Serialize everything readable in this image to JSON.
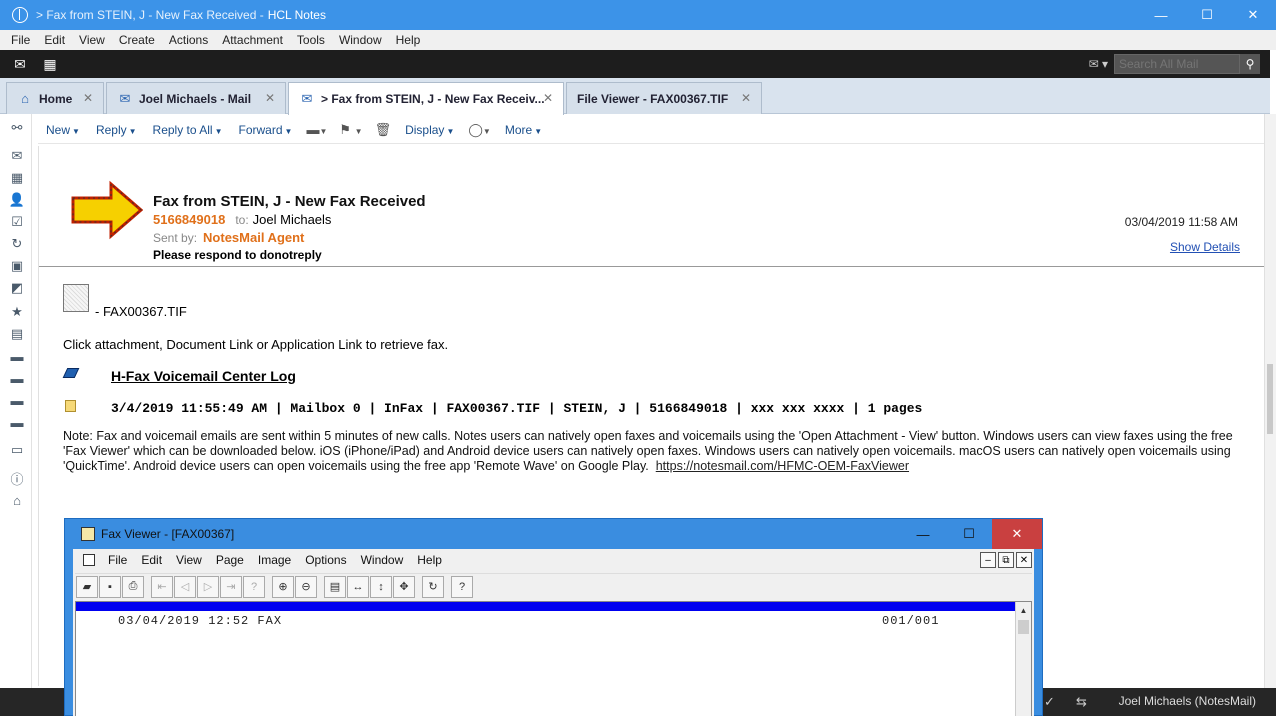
{
  "window": {
    "title_prefix": "> Fax from STEIN, J - New Fax Received  -",
    "app_name": "HCL Notes",
    "min": "—",
    "max": "☐",
    "close": "✕"
  },
  "menu": [
    "File",
    "Edit",
    "View",
    "Create",
    "Actions",
    "Attachment",
    "Tools",
    "Window",
    "Help"
  ],
  "search": {
    "placeholder": "Search All Mail",
    "mail_icon": "✉ ▾"
  },
  "tabs": [
    {
      "label": "Home",
      "icon": "home-icon",
      "close": "✕"
    },
    {
      "label": "Joel Michaels - Mail",
      "icon": "mail-icon",
      "close": "✕"
    },
    {
      "label": "> Fax from STEIN, J - New Fax Receiv...",
      "icon": "fax-doc-icon",
      "close": "✕"
    },
    {
      "label": "File Viewer - FAX00367.TIF",
      "icon": "",
      "close": "✕"
    }
  ],
  "actions": {
    "new": "New",
    "reply": "Reply",
    "reply_all": "Reply to All",
    "forward": "Forward",
    "display": "Display",
    "more": "More"
  },
  "message": {
    "subject": "Fax from STEIN, J - New Fax Received",
    "from_number": "5166849018",
    "to_label": "to:",
    "to": "Joel Michaels",
    "sent_by_label": "Sent by:",
    "sent_by": "NotesMail Agent",
    "respond_note": "Please respond to donotreply",
    "date": "03/04/2019 11:58 AM",
    "show_details": "Show Details",
    "attachment_name": "- FAX00367.TIF",
    "click_instruction": "Click attachment,  Document Link or Application Link to retrieve fax.",
    "voicemail_link": "H-Fax Voicemail Center Log",
    "log_line": "3/4/2019 11:55:49 AM | Mailbox 0 | InFax | FAX00367.TIF | STEIN, J | 5166849018 | xxx xxx xxxx | 1 pages",
    "note_text": "Note: Fax and voicemail emails are sent within 5 minutes of new calls.  Notes users can natively open faxes and voicemails using the 'Open Attachment - View' button.  Windows users can view faxes using the free 'Fax Viewer' which can be downloaded below.  iOS (iPhone/iPad) and Android device users can natively open faxes.  Windows users can natively open voicemails.  macOS users can natively open voicemails using 'QuickTime'.  Android device users can open voicemails using the free app 'Remote Wave' on Google Play.",
    "note_link": "https://notesmail.com/HFMC-OEM-FaxViewer"
  },
  "status": {
    "user": "Joel Michaels (NotesMail)"
  },
  "fax_viewer": {
    "title": "Fax Viewer - [FAX00367]",
    "menu": [
      "File",
      "Edit",
      "View",
      "Page",
      "Image",
      "Options",
      "Window",
      "Help"
    ],
    "fax_header": "03/04/2019 12:52 FAX",
    "page_indicator": "001/001"
  }
}
